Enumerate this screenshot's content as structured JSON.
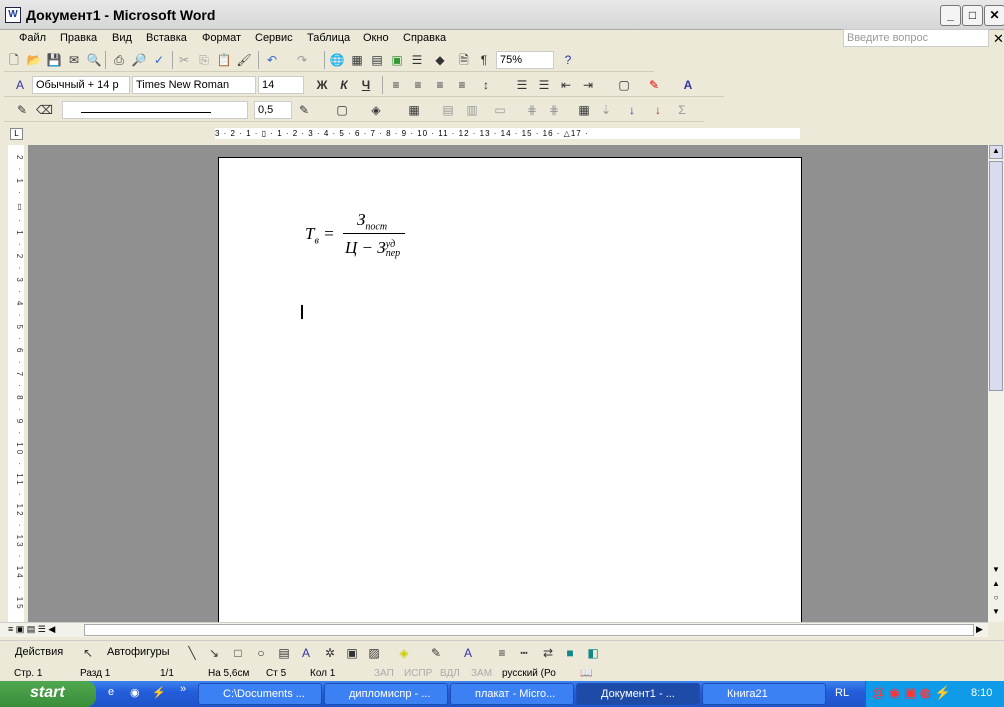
{
  "window": {
    "title": "Документ1 - Microsoft Word",
    "min": "_",
    "max": "□",
    "close": "✕"
  },
  "menu": [
    "Файл",
    "Правка",
    "Вид",
    "Вставка",
    "Формат",
    "Сервис",
    "Таблица",
    "Окно",
    "Справка"
  ],
  "ask_placeholder": "Введите вопрос",
  "toolbar": {
    "zoom": "75%",
    "style": "Обычный + 14 р",
    "font": "Times New Roman",
    "size": "14",
    "bold": "Ж",
    "italic": "К",
    "underline": "Ч",
    "line_weight": "0,5"
  },
  "ruler": {
    "h": "3 · 2 · 1 · ▯ · 1 · 2 · 3 · 4 · 5 · 6 · 7 · 8 · 9 · 10 · 11 · 12 · 13 · 14 · 15 · 16 · △17 ·",
    "v": "2 · 1 · ▯ · 1 · 2 · 3 · 4 · 5 · 6 · 7 · 8 · 9 · 10 · 11 · 12 · 13 · 14 · 15"
  },
  "formula": {
    "lhs": "T",
    "lhs_sub": "в",
    "num": "З",
    "num_sub": "пост",
    "den_a": "Ц",
    "den_b": "З",
    "den_sup": "уд",
    "den_sub": "пер"
  },
  "drawing": {
    "actions": "Действия",
    "autoshapes": "Автофигуры"
  },
  "status": {
    "page": "Стр. 1",
    "section": "Разд 1",
    "pages": "1/1",
    "at": "На 5,6см",
    "line": "Ст 5",
    "col": "Кол 1",
    "rec": "ЗАП",
    "trk": "ИСПР",
    "ext": "ВДЛ",
    "ovr": "ЗАМ",
    "lang": "русский (Ро"
  },
  "taskbar": {
    "start": "start",
    "tasks": [
      "C:\\Documents ...",
      "дипломиспр - ...",
      "плакат - Micro...",
      "Документ1 - ...",
      "Книга21"
    ],
    "lang": "RL",
    "clock": "8:10"
  }
}
